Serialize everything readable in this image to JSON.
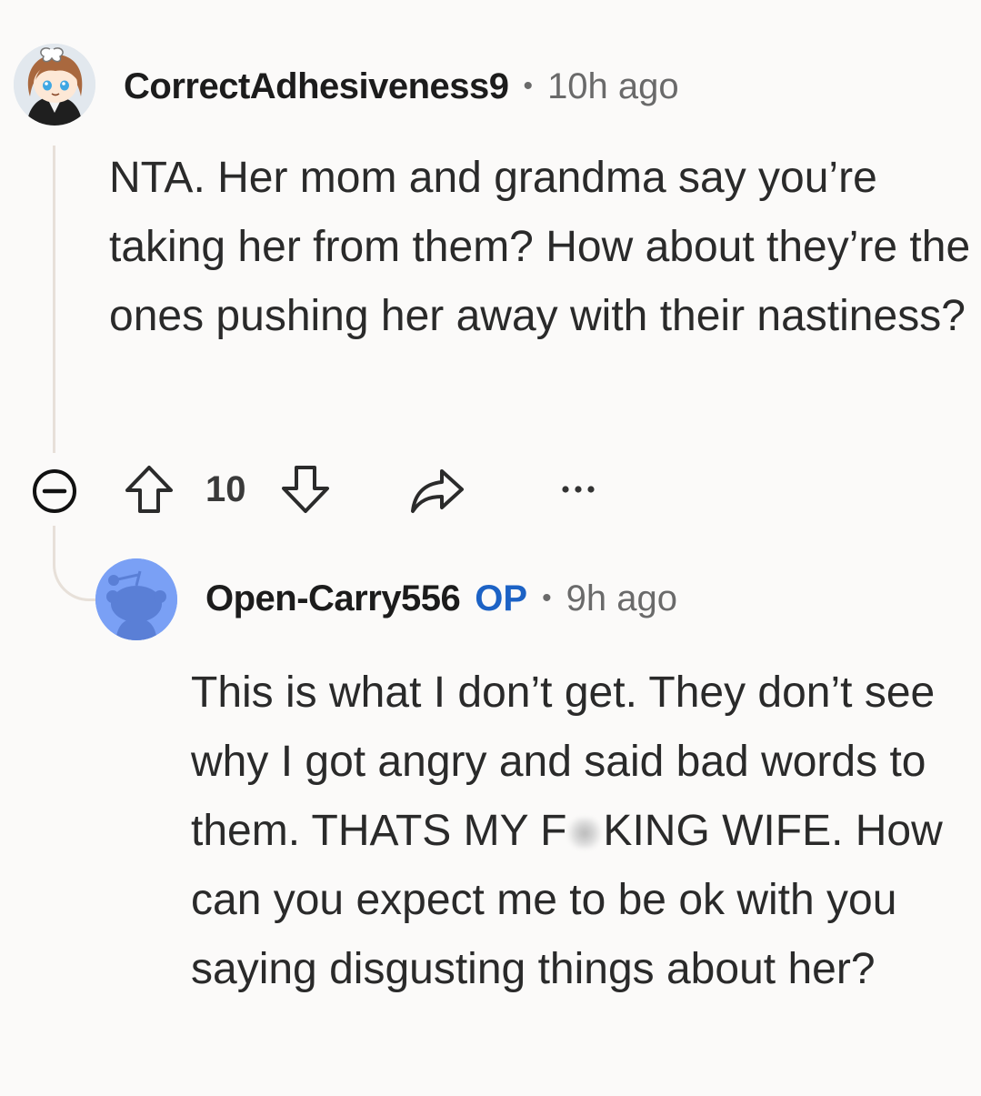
{
  "comments": [
    {
      "username": "CorrectAdhesiveness9",
      "separator": "•",
      "timestamp": "10h ago",
      "body": "NTA. Her mom and grandma say you’re taking her from them? How about they’re the ones pushing her away with their nastiness?",
      "vote_count": "10",
      "avatar": "snoo-girl-brown-hair-avatar"
    },
    {
      "username": "Open-Carry556",
      "badge": "OP",
      "separator": "•",
      "timestamp": "9h ago",
      "body_before_censor": "This is what I don’t get. They don’t see why I got angry and said bad words to them. THATS MY F",
      "body_after_censor": "KING WIFE. How can you expect me to be ok with you saying disgusting things about her?",
      "avatar": "default-snoo-avatar"
    }
  ],
  "icons": {
    "collapse": "collapse-minus-icon",
    "upvote": "upvote-arrow-icon",
    "downvote": "downvote-arrow-icon",
    "share": "share-arrow-icon",
    "more": "more-options-icon"
  },
  "colors": {
    "background": "#fbfaf9",
    "op_badge": "#1c62c5",
    "thread_line": "#e7e0d9",
    "meta_text": "#6a6a6a"
  }
}
